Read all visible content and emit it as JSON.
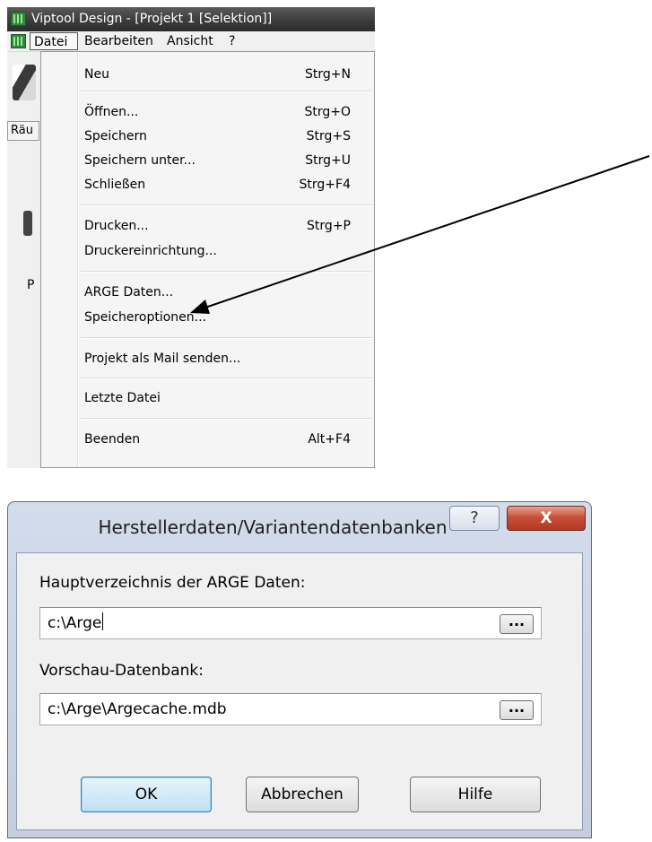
{
  "app": {
    "window_title": "Viptool Design - [Projekt 1 [Selektion]]",
    "menubar": [
      {
        "label": "Datei"
      },
      {
        "label": "Bearbeiten"
      },
      {
        "label": "Ansicht"
      },
      {
        "label": "?"
      }
    ],
    "background_fragments": {
      "side_tab": "Räu",
      "letter": "P"
    }
  },
  "file_menu": {
    "items": [
      {
        "label": "Neu",
        "shortcut": "Strg+N"
      },
      {
        "label": "Öffnen...",
        "shortcut": "Strg+O"
      },
      {
        "label": "Speichern",
        "shortcut": "Strg+S"
      },
      {
        "label": "Speichern unter...",
        "shortcut": "Strg+U"
      },
      {
        "label": "Schließen",
        "shortcut": "Strg+F4"
      },
      {
        "label": "Drucken...",
        "shortcut": "Strg+P"
      },
      {
        "label": "Druckereinrichtung...",
        "shortcut": ""
      },
      {
        "label": "ARGE Daten...",
        "shortcut": ""
      },
      {
        "label": "Speicheroptionen...",
        "shortcut": ""
      },
      {
        "label": "Projekt als Mail senden...",
        "shortcut": ""
      },
      {
        "label": "Letzte Datei",
        "shortcut": ""
      },
      {
        "label": "Beenden",
        "shortcut": "Alt+F4"
      }
    ]
  },
  "dialog": {
    "title": "Herstellerdaten/Variantendatenbanken",
    "help_glyph": "?",
    "close_glyph": "X",
    "main_dir_label": "Hauptverzeichnis der ARGE Daten:",
    "main_dir_value": "c:\\Arge",
    "preview_db_label": "Vorschau-Datenbank:",
    "preview_db_value": "c:\\Arge\\Argecache.mdb",
    "browse_label": "...",
    "buttons": {
      "ok": "OK",
      "cancel": "Abbrechen",
      "help": "Hilfe"
    }
  },
  "colors": {
    "annotation_arrow": "#000000",
    "close_button": "#c8503a",
    "ok_button_border": "#3c7fb1"
  }
}
